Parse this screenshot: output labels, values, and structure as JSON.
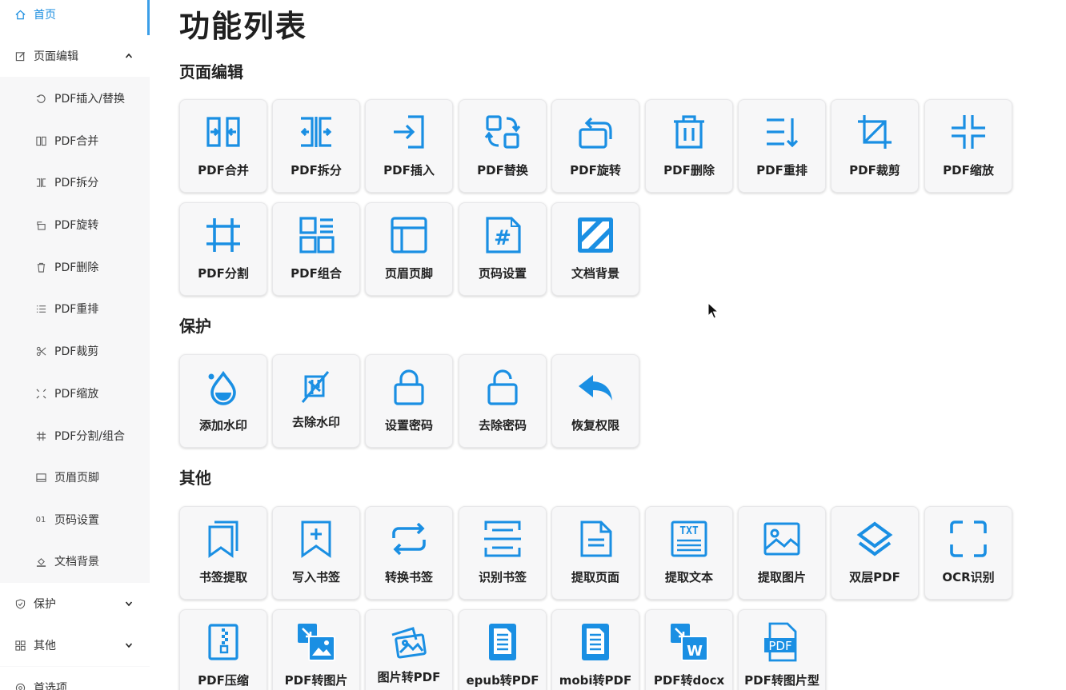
{
  "colors": {
    "accent": "#1b8ee0",
    "icon_blue": "#1a8fe3"
  },
  "sidebar": {
    "items": [
      {
        "label": "首页",
        "icon": "home-icon",
        "active": true
      },
      {
        "label": "页面编辑",
        "icon": "edit-icon",
        "expanded": true
      },
      {
        "label": "PDF插入/替换",
        "icon": "replace-icon"
      },
      {
        "label": "PDF合并",
        "icon": "merge-icon"
      },
      {
        "label": "PDF拆分",
        "icon": "split-icon"
      },
      {
        "label": "PDF旋转",
        "icon": "rotate-icon"
      },
      {
        "label": "PDF删除",
        "icon": "trash-icon"
      },
      {
        "label": "PDF重排",
        "icon": "list-icon"
      },
      {
        "label": "PDF裁剪",
        "icon": "scissors-icon"
      },
      {
        "label": "PDF缩放",
        "icon": "shrink-icon"
      },
      {
        "label": "PDF分割/组合",
        "icon": "hash-icon"
      },
      {
        "label": "页眉页脚",
        "icon": "header-footer-icon"
      },
      {
        "label": "页码设置",
        "icon": "page-number-icon"
      },
      {
        "label": "文档背景",
        "icon": "fill-icon"
      },
      {
        "label": "保护",
        "icon": "shield-icon"
      },
      {
        "label": "其他",
        "icon": "grid-icon"
      },
      {
        "label": "首选项",
        "icon": "settings-icon"
      }
    ],
    "page_number_glyph": "01"
  },
  "main": {
    "title": "功能列表",
    "sections": [
      {
        "title": "页面编辑",
        "items": [
          "PDF合并",
          "PDF拆分",
          "PDF插入",
          "PDF替换",
          "PDF旋转",
          "PDF删除",
          "PDF重排",
          "PDF裁剪",
          "PDF缩放",
          "PDF分割",
          "PDF组合",
          "页眉页脚",
          "页码设置",
          "文档背景"
        ]
      },
      {
        "title": "保护",
        "items": [
          "添加水印",
          "去除水印",
          "设置密码",
          "去除密码",
          "恢复权限"
        ]
      },
      {
        "title": "其他",
        "items": [
          "书签提取",
          "写入书签",
          "转换书签",
          "识别书签",
          "提取页面",
          "提取文本",
          "提取图片",
          "双层PDF",
          "OCR识别",
          "PDF压缩",
          "PDF转图片",
          "图片转PDF",
          "epub转PDF",
          "mobi转PDF",
          "PDF转docx",
          "PDF转图片型"
        ]
      }
    ],
    "icon_glyphs": {
      "txt": "TXT",
      "pdf": "PDF",
      "w": "W",
      "hash": "#"
    }
  }
}
